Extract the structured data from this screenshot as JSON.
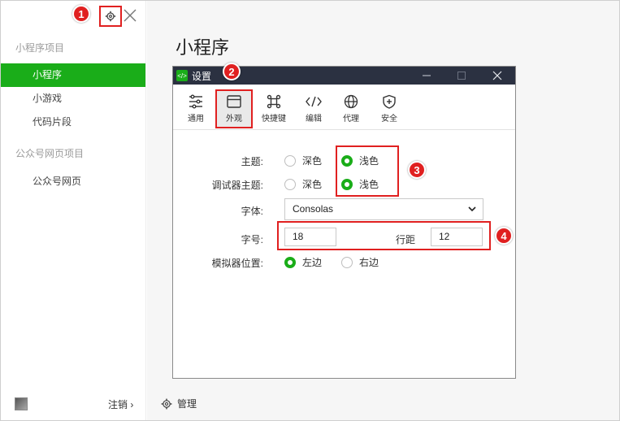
{
  "sidebar": {
    "project_section": "小程序项目",
    "items": [
      {
        "label": "小程序",
        "active": true
      },
      {
        "label": "小游戏",
        "active": false
      },
      {
        "label": "代码片段",
        "active": false
      }
    ],
    "web_section": "公众号网页项目",
    "web_items": [
      {
        "label": "公众号网页"
      }
    ],
    "logout": "注销 ›"
  },
  "main": {
    "title": "小程序",
    "manage": "管理"
  },
  "markers": [
    "1",
    "2",
    "3",
    "4"
  ],
  "dialog": {
    "title": "设置",
    "tabs": [
      {
        "label": "通用",
        "icon": "sliders-icon"
      },
      {
        "label": "外观",
        "icon": "window-icon",
        "selected": true
      },
      {
        "label": "快捷键",
        "icon": "command-key-icon"
      },
      {
        "label": "编辑",
        "icon": "code-icon"
      },
      {
        "label": "代理",
        "icon": "globe-icon"
      },
      {
        "label": "安全",
        "icon": "shield-icon"
      }
    ],
    "theme": {
      "label": "主题:",
      "options": [
        "深色",
        "浅色"
      ],
      "selected": "浅色"
    },
    "debugger_theme": {
      "label": "调试器主题:",
      "options": [
        "深色",
        "浅色"
      ],
      "selected": "浅色"
    },
    "font": {
      "label": "字体:",
      "value": "Consolas"
    },
    "font_size": {
      "label": "字号:",
      "value": "18"
    },
    "line_height": {
      "label": "行距",
      "value": "12"
    },
    "simulator_position": {
      "label": "模拟器位置:",
      "options": [
        "左边",
        "右边"
      ],
      "selected": "左边"
    }
  },
  "colors": {
    "accent": "#1aad19",
    "highlight": "#e02020",
    "titlebar": "#2b3141"
  }
}
